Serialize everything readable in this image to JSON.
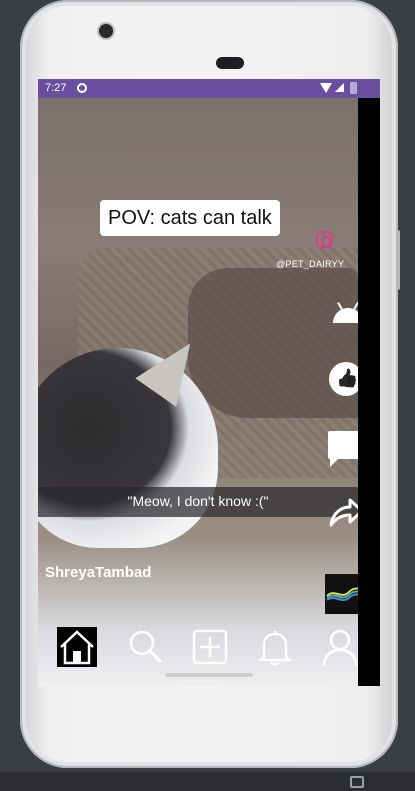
{
  "status_bar": {
    "time": "7:27",
    "icons": [
      "app-notification-icon",
      "wifi-icon",
      "signal-icon",
      "battery-icon"
    ]
  },
  "video": {
    "caption": "POV: cats can talk",
    "subtitle": "\"Meow, I don't know :(\"",
    "watermark_handle": "@PET_DAIRYY",
    "watermark_icon": "instagram-icon"
  },
  "feed": {
    "username": "ShreyaTambad",
    "side_actions": [
      "android-icon",
      "like-icon",
      "comment-icon",
      "share-icon"
    ],
    "music_thumbnail": "music-disc-thumbnail"
  },
  "bottom_nav": {
    "items": [
      "home-icon",
      "search-icon",
      "add-icon",
      "bell-icon",
      "profile-icon"
    ],
    "active": "home-icon"
  },
  "colors": {
    "status_bar": "#6a4fa0",
    "icon": "#ffffff",
    "caption_bg": "#ffffff"
  }
}
